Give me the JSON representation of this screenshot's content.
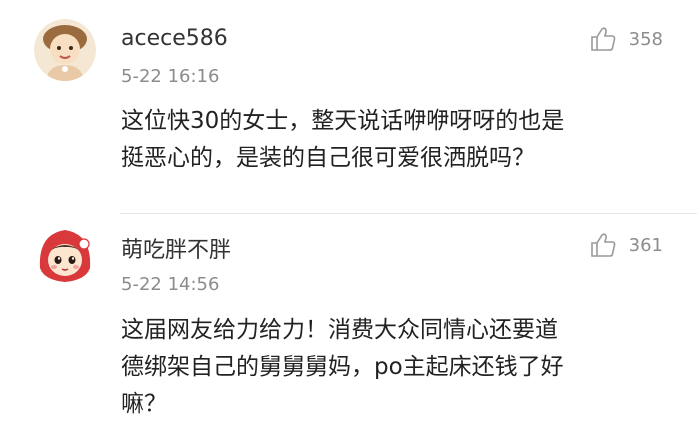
{
  "comments": [
    {
      "username": "acece586",
      "time": "5-22 16:16",
      "like_count": "358",
      "avatar_icon": "cartoon-girl-avatar-icon",
      "content_lines": [
        "这位快30的女士，整天说话咿咿呀呀的也是",
        "挺恶心的，是装的自己很可爱很洒脱吗？"
      ]
    },
    {
      "username": "萌吃胖不胖",
      "time": "5-22 14:56",
      "like_count": "361",
      "avatar_icon": "red-hood-girl-avatar-icon",
      "content_lines": [
        "这届网友给力给力！消费大众同情心还要道",
        "德绑架自己的舅舅舅妈，po主起床还钱了好",
        "嘛？"
      ]
    }
  ],
  "icons": {
    "like": "thumbs-up-icon"
  },
  "colors": {
    "text": "#222222",
    "meta": "#8c8c8c",
    "divider": "#e6e6e6"
  }
}
